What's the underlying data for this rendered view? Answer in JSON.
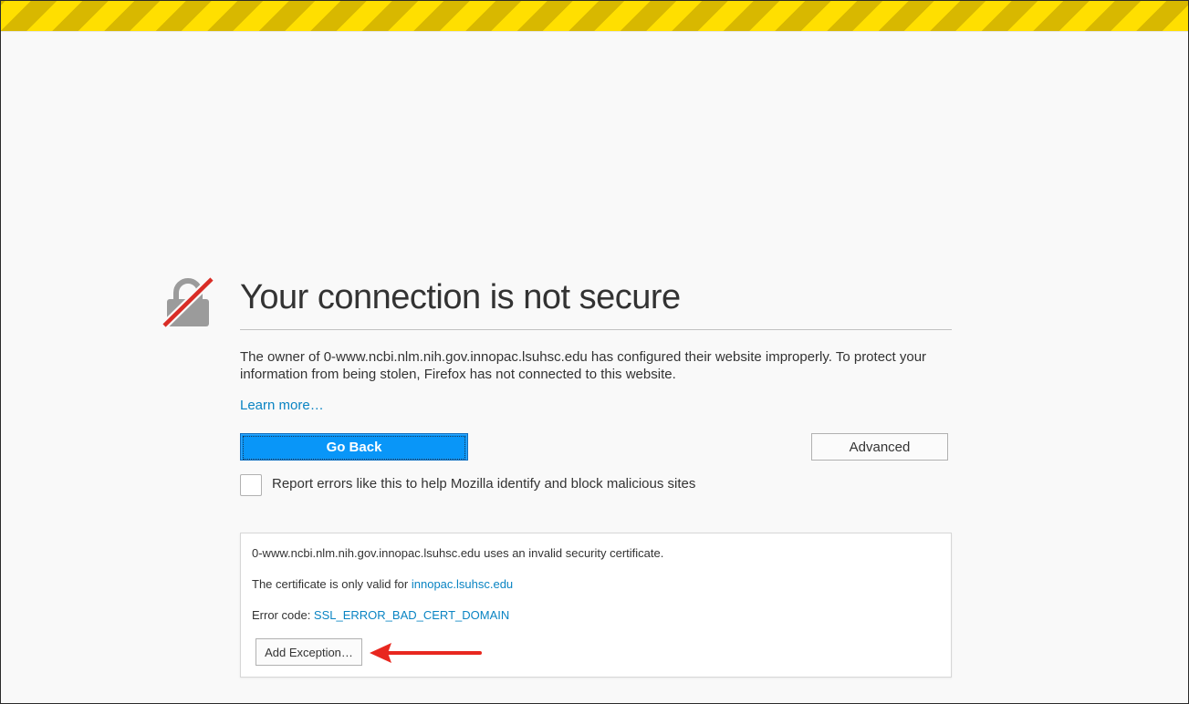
{
  "page": {
    "title": "Your connection is not secure",
    "description": "The owner of 0-www.ncbi.nlm.nih.gov.innopac.lsuhsc.edu has configured their website improperly. To protect your information from being stolen, Firefox has not connected to this website.",
    "learn_more": "Learn more…",
    "icon": "broken-lock-icon"
  },
  "actions": {
    "go_back_label": "Go Back",
    "advanced_label": "Advanced"
  },
  "report": {
    "label": "Report errors like this to help Mozilla identify and block malicious sites",
    "checked": false
  },
  "details": {
    "invalid_cert_text": "0-www.ncbi.nlm.nih.gov.innopac.lsuhsc.edu uses an invalid security certificate.",
    "valid_for_prefix": "The certificate is only valid for ",
    "valid_for_domain": "innopac.lsuhsc.edu",
    "error_code_prefix": "Error code: ",
    "error_code": "SSL_ERROR_BAD_CERT_DOMAIN",
    "add_exception_label": "Add Exception…"
  },
  "colors": {
    "stripe_yellow": "#ffdf00",
    "stripe_dark": "#d8b800",
    "primary_button": "#0996f8",
    "link": "#0a84c3",
    "annotation_arrow": "#e8271f",
    "lock_strike": "#d92d26",
    "lock_body": "#9b9b9b"
  }
}
